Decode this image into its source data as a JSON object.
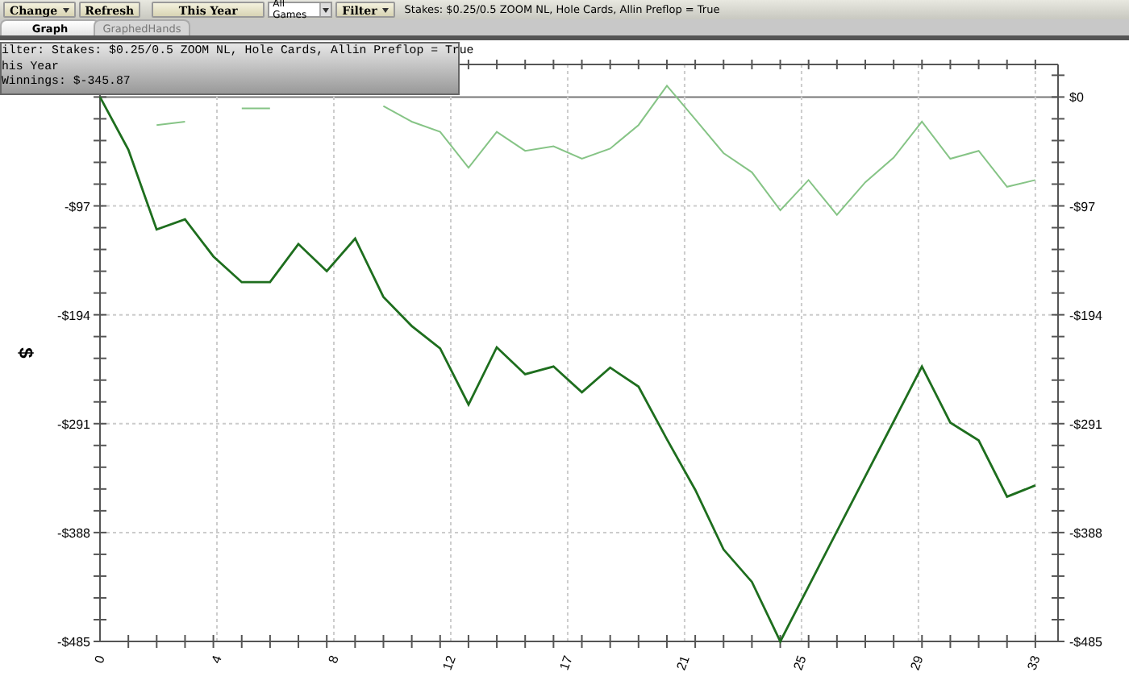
{
  "toolbar": {
    "buttons": [
      {
        "label": "Change",
        "kind": "menu"
      },
      {
        "label": "Refresh",
        "kind": "plain"
      },
      {
        "label": "This Year",
        "kind": "wide"
      }
    ],
    "game_select": {
      "value": "All Games"
    },
    "filter_button": {
      "label": "Filter"
    },
    "filter_summary": "Stakes: $0.25/0.5 ZOOM NL, Hole Cards, Allin Preflop = True"
  },
  "tabs": [
    {
      "label": "Graph",
      "selected": true
    },
    {
      "label": "GraphedHands",
      "selected": false
    }
  ],
  "graph": {
    "tooltip": [
      "ilter: Stakes: $0.25/0.5 ZOOM NL, Hole Cards, Allin Preflop = True",
      "his Year",
      "Winnings: $-345.87"
    ],
    "chart_data": {
      "type": "line",
      "ylabel": "$",
      "x": [
        0,
        1,
        2,
        3,
        4,
        5,
        6,
        7,
        8,
        9,
        10,
        11,
        12,
        13,
        14,
        15,
        16,
        17,
        18,
        19,
        20,
        21,
        22,
        23,
        24,
        25,
        26,
        27,
        28,
        29,
        30,
        31,
        32,
        33
      ],
      "series": [
        {
          "color": "#86c486",
          "values": [
            null,
            null,
            -25,
            -22,
            null,
            -10,
            -10,
            null,
            null,
            null,
            -8,
            -22,
            -31,
            -63,
            -31,
            -48,
            -44,
            -55,
            -46,
            -25,
            10,
            -20,
            -50,
            -67,
            -101,
            -74,
            -105,
            -76,
            -54,
            -22,
            -55,
            -48,
            -80,
            -74
          ]
        },
        {
          "color": "#1e6e1e",
          "values": [
            0,
            -47,
            -118,
            -109,
            -142,
            -165,
            -165,
            -131,
            -155,
            -126,
            -178,
            -204,
            -224,
            -274,
            -223,
            -247,
            -240,
            -263,
            -241,
            -258,
            -305,
            -350,
            -403,
            -432,
            -485,
            -436,
            -387,
            -338,
            -289,
            -240,
            -290,
            -306,
            -356,
            -346
          ]
        }
      ],
      "grid": true,
      "xlim": [
        0,
        33.8
      ],
      "ylim": [
        -485,
        29
      ],
      "xticks": [
        {
          "value": 0,
          "label": "0"
        },
        {
          "value": 4.125,
          "label": "4"
        },
        {
          "value": 8.25,
          "label": "8"
        },
        {
          "value": 12.375,
          "label": "12"
        },
        {
          "value": 16.5,
          "label": "17"
        },
        {
          "value": 20.625,
          "label": "21"
        },
        {
          "value": 24.75,
          "label": "25"
        },
        {
          "value": 28.875,
          "label": "29"
        },
        {
          "value": 33,
          "label": "33"
        }
      ],
      "yticks": [
        {
          "value": 0,
          "label": "$0"
        },
        {
          "value": -97,
          "label": "-$97"
        },
        {
          "value": -194,
          "label": "-$194"
        },
        {
          "value": -291,
          "label": "-$291"
        },
        {
          "value": -388,
          "label": "-$388"
        },
        {
          "value": -485,
          "label": "-$485"
        }
      ]
    }
  }
}
